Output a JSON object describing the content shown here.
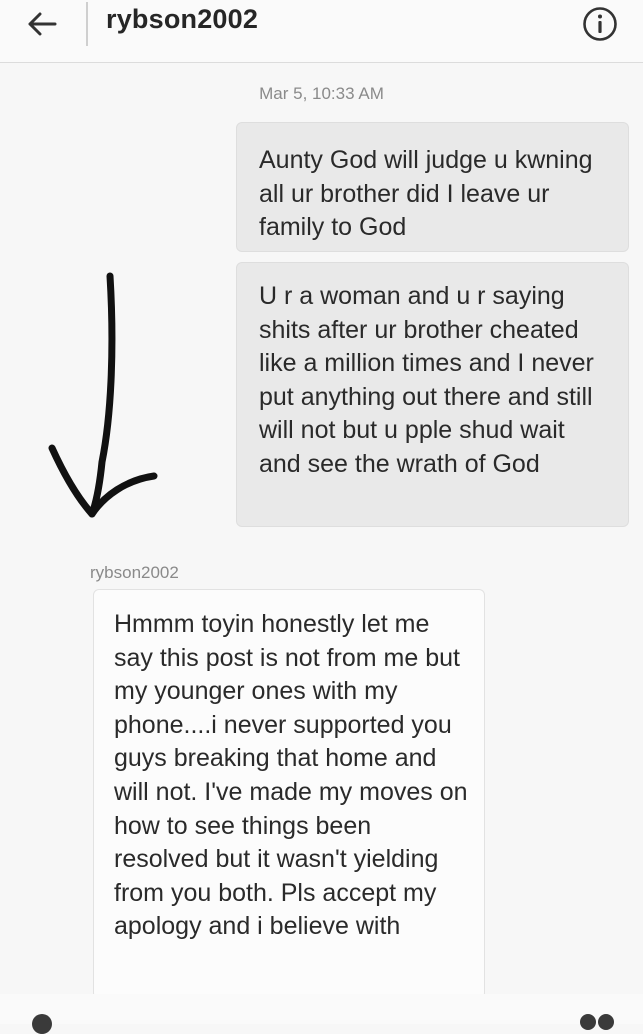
{
  "header": {
    "back_icon": "arrow-left-icon",
    "title": "rybson2002",
    "info_icon": "info-circle-icon"
  },
  "thread": {
    "timestamp": "Mar 5, 10:33 AM",
    "outgoing": [
      "Aunty God will judge u kwning all ur brother did I leave ur family to God",
      "U r a woman and u r saying shits after ur brother cheated like a million times and I never put anything out there and still will not but u pple shud wait and see the wrath of God"
    ],
    "sender": "rybson2002",
    "incoming": [
      "Hmmm toyin honestly let me say this post is not from me but my younger ones with my phone....i never supported you guys breaking that home and will not. I've made my moves on how to see things been  resolved but it wasn't yielding from you both. Pls accept my apology and i believe with"
    ]
  },
  "annotation": {
    "arrow_icon": "hand-drawn-down-arrow"
  },
  "colors": {
    "outgoing_bubble": "#e9e9e9",
    "incoming_bubble": "#fcfcfc",
    "text": "#2a2a2a",
    "meta_text": "#8a8a8a"
  }
}
